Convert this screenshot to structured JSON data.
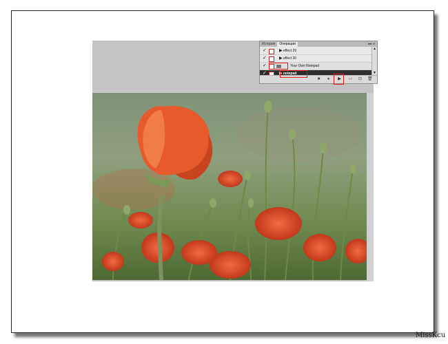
{
  "panel": {
    "tabs": [
      "История",
      "Операции"
    ],
    "controls": "▸▸ ≡",
    "rows": [
      {
        "check": "✓",
        "label": "effect 29"
      },
      {
        "check": "✓",
        "label": "effect 30"
      },
      {
        "check": "✓",
        "label": "Your Own Notepad"
      },
      {
        "check": "✓",
        "label": "notepad"
      }
    ]
  },
  "icons": {
    "tri": "▶",
    "stop": "■",
    "record": "●",
    "play": "▶",
    "new_set": "▭",
    "new_action": "⊡",
    "delete": "🗑"
  },
  "credit": "MissKcu"
}
